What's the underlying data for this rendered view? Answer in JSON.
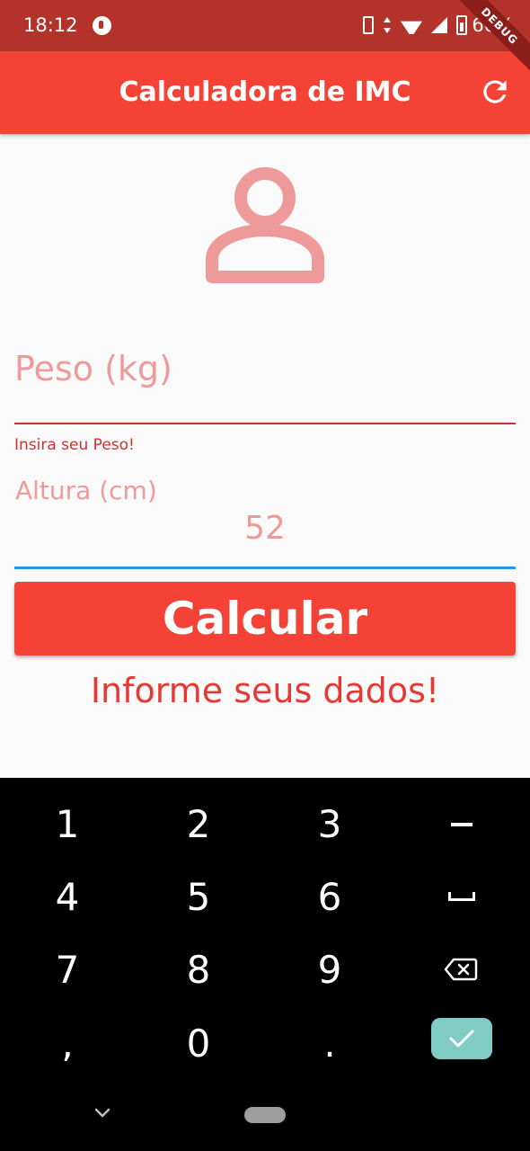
{
  "status_bar": {
    "time": "18:12",
    "battery_text": "66%",
    "icons": [
      "app-notification-icon",
      "vibrate-icon",
      "data-arrows-icon",
      "wifi-icon",
      "signal-icon",
      "battery-icon"
    ]
  },
  "debug_banner": "DEBUG",
  "app_bar": {
    "title": "Calculadora de IMC",
    "action_icon": "refresh-icon"
  },
  "form": {
    "header_icon": "person-outline-icon",
    "peso": {
      "label": "Peso (kg)",
      "value": "",
      "error": "Insira seu Peso!"
    },
    "altura": {
      "label": "Altura (cm)",
      "value": "52"
    },
    "calcular_label": "Calcular",
    "info": "Informe seus dados!"
  },
  "keyboard": {
    "rows": [
      [
        "1",
        "2",
        "3",
        "-"
      ],
      [
        "4",
        "5",
        "6",
        "space"
      ],
      [
        "7",
        "8",
        "9",
        "backspace"
      ],
      [
        ",",
        "0",
        ".",
        "done"
      ]
    ],
    "done_color": "#80cbc4"
  },
  "colors": {
    "primary": "#f44336",
    "status_bar": "#b3322a",
    "error": "#d32f2f",
    "focus_line": "#2196f3",
    "hint": "#ef9a9a"
  }
}
